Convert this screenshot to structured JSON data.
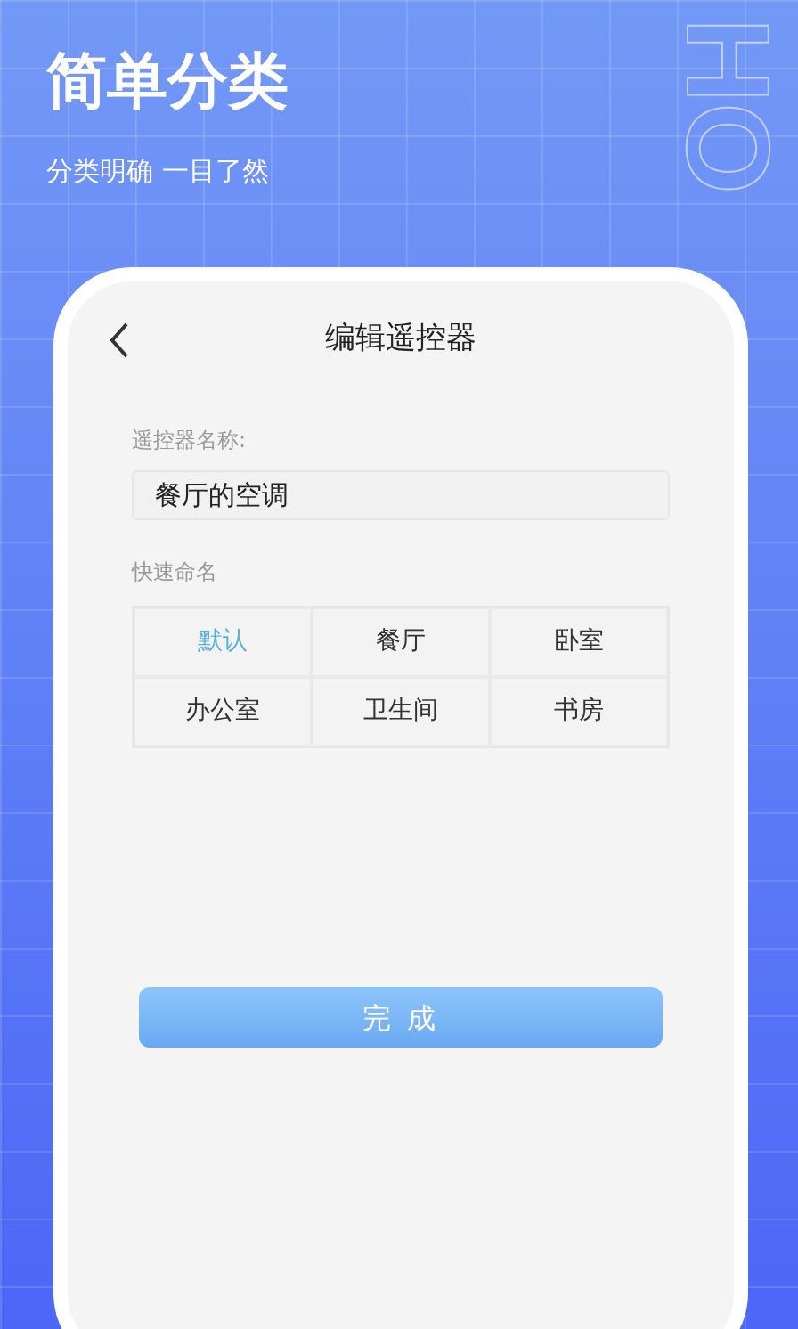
{
  "headline": "简单分类",
  "subheadline": "分类明确 一目了然",
  "decor_text": "HO",
  "screen": {
    "title": "编辑遥控器",
    "name_label": "遥控器名称:",
    "name_value": "餐厅的空调",
    "quick_label": "快速命名",
    "quick_names": [
      {
        "label": "默认",
        "selected": true
      },
      {
        "label": "餐厅",
        "selected": false
      },
      {
        "label": "卧室",
        "selected": false
      },
      {
        "label": "办公室",
        "selected": false
      },
      {
        "label": "卫生间",
        "selected": false
      },
      {
        "label": "书房",
        "selected": false
      }
    ],
    "done_button": "完 成"
  }
}
